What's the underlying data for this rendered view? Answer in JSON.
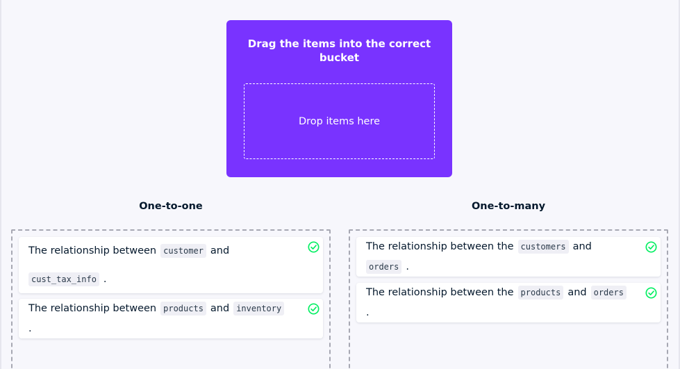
{
  "source": {
    "title": "Drag the items into the correct bucket",
    "drop_placeholder": "Drop items here"
  },
  "buckets": [
    {
      "title": "One-to-one",
      "items": [
        {
          "prefix": "The relationship between",
          "a": "customer",
          "joiner": "and",
          "b": "cust_tax_info",
          "suffix": ".",
          "status": "correct"
        },
        {
          "prefix": "The relationship between",
          "a": "products",
          "joiner": "and",
          "b": "inventory",
          "suffix": ".",
          "status": "correct"
        }
      ]
    },
    {
      "title": "One-to-many",
      "items": [
        {
          "prefix": "The relationship between the",
          "a": "customers",
          "joiner": "and",
          "b": "orders",
          "suffix": ".",
          "status": "correct"
        },
        {
          "prefix": "The relationship between the",
          "a": "products",
          "joiner": "and",
          "b": "orders",
          "suffix": ".",
          "status": "correct"
        }
      ]
    }
  ],
  "colors": {
    "accent": "#7933ff",
    "success": "#03ef62",
    "text": "#05192d"
  },
  "icons": {
    "correct": "check-circle-icon"
  }
}
